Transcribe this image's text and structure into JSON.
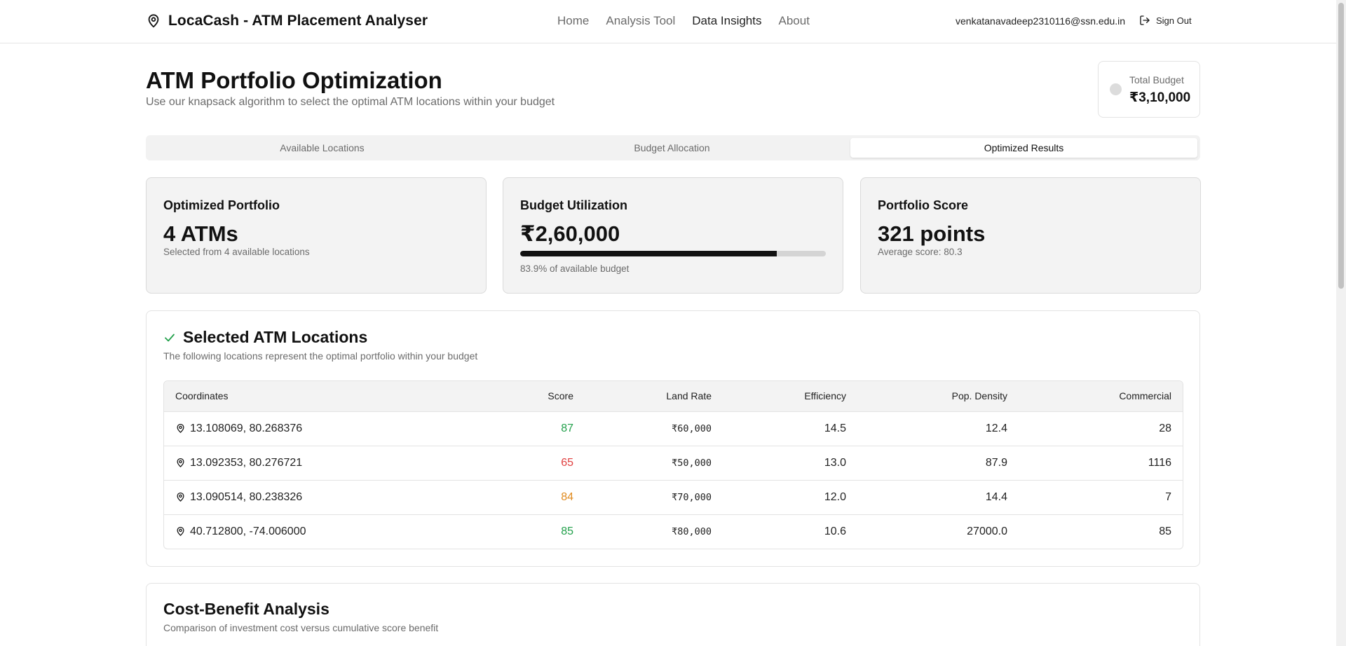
{
  "header": {
    "brand": "LocaCash - ATM Placement Analyser",
    "nav": [
      "Home",
      "Analysis Tool",
      "Data Insights",
      "About"
    ],
    "user_email": "venkatanavadeep2310116@ssn.edu.in",
    "sign_out": "Sign Out"
  },
  "page": {
    "title": "ATM Portfolio Optimization",
    "subtitle": "Use our knapsack algorithm to select the optimal ATM locations within your budget"
  },
  "budget": {
    "label": "Total Budget",
    "value": "₹3,10,000"
  },
  "tabs": [
    "Available Locations",
    "Budget Allocation",
    "Optimized Results"
  ],
  "active_tab": "Optimized Results",
  "stats": {
    "portfolio": {
      "label": "Optimized Portfolio",
      "value": "4 ATMs",
      "sub": "Selected from 4 available locations"
    },
    "utilization": {
      "label": "Budget Utilization",
      "value": "₹2,60,000",
      "percent": 83.9,
      "sub": "83.9% of available budget"
    },
    "score": {
      "label": "Portfolio Score",
      "value": "321 points",
      "sub": "Average score: 80.3"
    }
  },
  "selected": {
    "title": "Selected ATM Locations",
    "subtitle": "The following locations represent the optimal portfolio within your budget",
    "columns": [
      "Coordinates",
      "Score",
      "Land Rate",
      "Efficiency",
      "Pop. Density",
      "Commercial"
    ],
    "rows": [
      {
        "coords": "13.108069, 80.268376",
        "score": "87",
        "score_color": "#22a04b",
        "land_rate": "₹60,000",
        "efficiency": "14.5",
        "pop_density": "12.4",
        "commercial": "28"
      },
      {
        "coords": "13.092353, 80.276721",
        "score": "65",
        "score_color": "#e04040",
        "land_rate": "₹50,000",
        "efficiency": "13.0",
        "pop_density": "87.9",
        "commercial": "1116"
      },
      {
        "coords": "13.090514, 80.238326",
        "score": "84",
        "score_color": "#e08a1e",
        "land_rate": "₹70,000",
        "efficiency": "12.0",
        "pop_density": "14.4",
        "commercial": "7"
      },
      {
        "coords": "40.712800, -74.006000",
        "score": "85",
        "score_color": "#22a04b",
        "land_rate": "₹80,000",
        "efficiency": "10.6",
        "pop_density": "27000.0",
        "commercial": "85"
      }
    ]
  },
  "cost_benefit": {
    "title": "Cost-Benefit Analysis",
    "subtitle": "Comparison of investment cost versus cumulative score benefit"
  },
  "colors": {
    "accent_check": "#22a04b",
    "progress_fill": "#111111"
  }
}
